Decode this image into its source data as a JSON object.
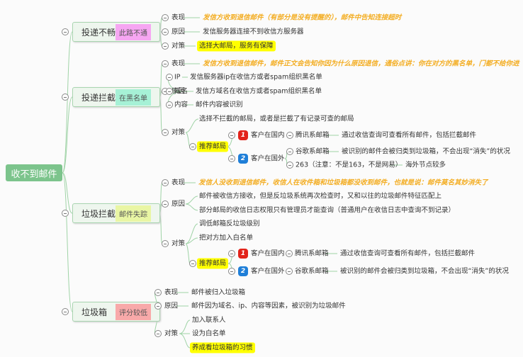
{
  "root": "收不到邮件",
  "labels": {
    "biaoxian": "表现",
    "yuanyin": "原因",
    "duice": "对策",
    "tuijian": "推荐邮局",
    "domestic": "客户在国内",
    "abroad": "客户在国外",
    "tencent": "腾讯系邮箱",
    "google": "谷歌系邮箱",
    "n1": "1",
    "n2": "2"
  },
  "b1": {
    "title": "投递不畅",
    "tag": "此路不通",
    "tag_color": "#f6a6f2",
    "biaoxian": "发信方收到退信邮件（有部分是没有提醒的），邮件中告知连接超时",
    "yuanyin": "发信服务器连接不到收信方服务器",
    "duice": "选择大邮局，服务有保障"
  },
  "b2": {
    "title": "投递拦截",
    "tag": "在黑名单",
    "tag_color": "#a6f1d6",
    "biaoxian": "发信方收到退信邮件，邮件正文会告知你因为什么原因退信，通俗点讲：你在对方的黑名单，门都不给你进",
    "ip_label": "IP",
    "ip": "发信服务器ip在收信方或者spam组织黑名单",
    "domain_label": "域名",
    "domain": "发信方域名在收信方或者spam组织黑名单",
    "content_label": "内容",
    "content": "邮件内容被识别",
    "duice1": "选择不拦截的邮局，或者是拦截了有记录可查的邮局",
    "tencent": "通过收信查询可查看所有邮件，包括拦截邮件",
    "google": "被识别的邮件会被归类到垃圾箱，不会出现“消失”的状况",
    "n263": "263（注意：不是163，不是网易）",
    "n263_desc": "海外节点较多"
  },
  "b3": {
    "title": "垃圾拦截",
    "tag": "邮件失踪",
    "tag_color": "#e9f6a4",
    "biaoxian": "发信人没收到退信邮件，收信人在收件箱和垃圾箱都没收到邮件，也就是说：邮件莫名其妙消失了",
    "yuanyin1": "邮件被收信方接收，但是反垃圾系统再次检查时，又和以往的垃圾邮件特征匹配上",
    "yuanyin2": "部分邮局的收信日志权限只有管理员才能查询（普通用户在收信日志中查询不到记录）",
    "duice1": "调低邮箱反垃圾级别",
    "duice2": "把对方加入白名单",
    "tencent": "通过收信查询可查看所有邮件，包括拦截邮件",
    "google": "被识别的邮件会被归类到垃圾箱，不会出现“消失”的状况"
  },
  "b4": {
    "title": "垃圾箱",
    "tag": "评分较低",
    "tag_color": "#f8a9a9",
    "biaoxian": "邮件被归入垃圾箱",
    "yuanyin": "邮件因为域名、ip、内容等因素，被识别为垃圾邮件",
    "duice1": "加入联系人",
    "duice2": "设为白名单",
    "duice3": "养成看垃圾箱的习惯"
  },
  "colors": {
    "line": "#9fd3a6",
    "orange": "#f3ad22",
    "highlight": "#ffff00"
  }
}
